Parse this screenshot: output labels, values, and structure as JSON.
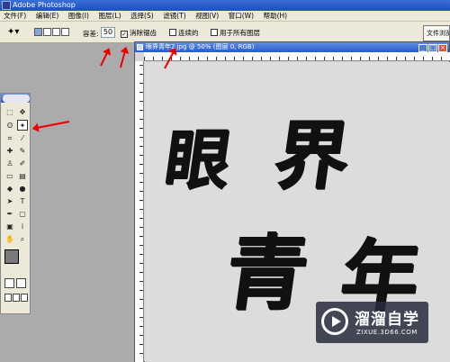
{
  "app": {
    "title": "Adobe Photoshop"
  },
  "menu": [
    "文件(F)",
    "编辑(E)",
    "图像(I)",
    "图层(L)",
    "选择(S)",
    "滤镜(T)",
    "视图(V)",
    "窗口(W)",
    "帮助(H)"
  ],
  "options": {
    "tolerance_label": "容差:",
    "tolerance_value": "50",
    "antialias_label": "消除锯齿",
    "antialias_checked": "✓",
    "contiguous_label": "连续的",
    "all_layers_label": "用于所有图层",
    "workspace_label": "文件浏览"
  },
  "document": {
    "title": "眼界青年2.jpg @ 50% (图层 0, RGB)",
    "glyphs": [
      "眼",
      "界",
      "青",
      "年"
    ]
  },
  "colors": {
    "foreground": "#7a7a7a",
    "background": "#8a3a3a",
    "annotation": "#ee0000"
  },
  "watermark": {
    "title": "溜溜自学",
    "sub": "ZIXUE.3D66.COM"
  }
}
